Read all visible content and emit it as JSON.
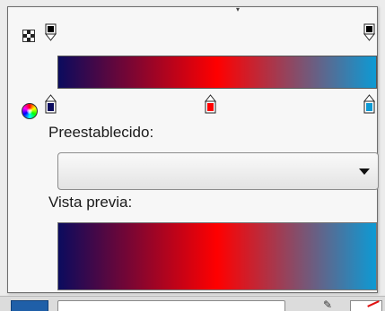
{
  "gradient": {
    "colors": [
      "#0b0b5e",
      "#ff0000",
      "#0d9ad4"
    ],
    "stops": [
      {
        "position": 0.0,
        "color": "#0b0b5e"
      },
      {
        "position": 0.5,
        "color": "#ff0000"
      },
      {
        "position": 1.0,
        "color": "#0d9ad4"
      }
    ],
    "opacity_stops": [
      {
        "position": 0.0,
        "color": "#000000"
      },
      {
        "position": 1.0,
        "color": "#000000"
      }
    ]
  },
  "preset": {
    "label": "Preestablecido:",
    "selected": ""
  },
  "preview": {
    "label": "Vista previa:"
  },
  "icons": {
    "transparency": "checker-icon",
    "color_picker": "color-wheel-icon",
    "dropdown": "chevron-down-icon"
  }
}
